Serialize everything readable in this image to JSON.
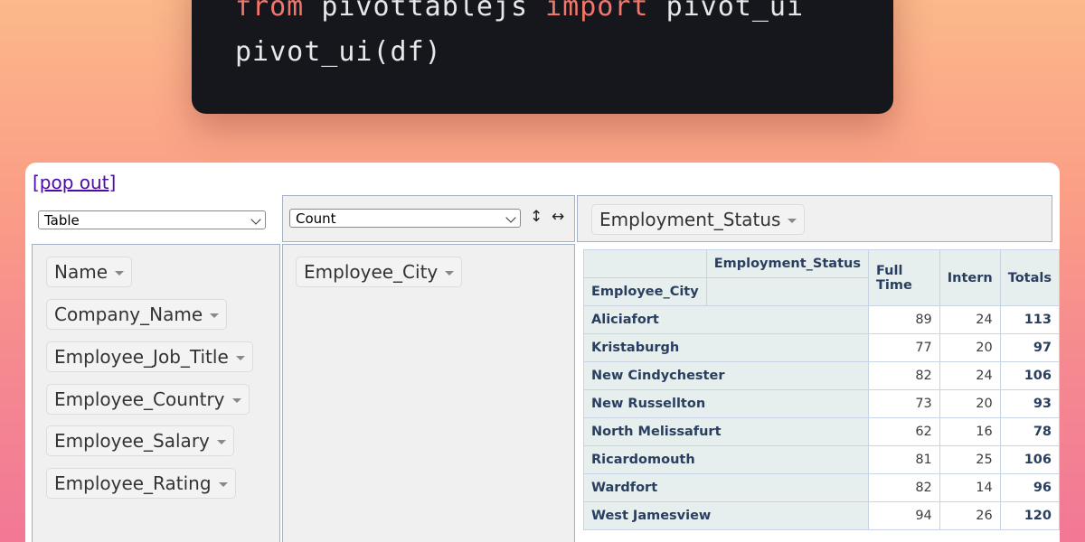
{
  "code": {
    "line1": {
      "kw1": "from",
      "mod": "pivottablejs",
      "kw2": "import",
      "name": "pivot_ui"
    },
    "line2": "pivot_ui(df)"
  },
  "colors": {
    "code_bg": "#15171c",
    "keyword": "#f2766c",
    "link": "#4b0ca8",
    "header_bg": "#e6eeee",
    "header_text": "#2a3f5f"
  },
  "popout_link": "[pop out]",
  "renderer_select": {
    "value": "Table"
  },
  "aggregator_select": {
    "value": "Count"
  },
  "sort_controls": {
    "row_order": "↕",
    "col_order": "↔"
  },
  "column_attributes": [
    {
      "label": "Employment_Status"
    }
  ],
  "row_attributes": [
    {
      "label": "Employee_City"
    }
  ],
  "unused_attributes": [
    {
      "label": "Name"
    },
    {
      "label": "Company_Name"
    },
    {
      "label": "Employee_Job_Title"
    },
    {
      "label": "Employee_Country"
    },
    {
      "label": "Employee_Salary"
    },
    {
      "label": "Employee_Rating"
    }
  ],
  "pivot_table": {
    "col_attr_header": "Employment_Status",
    "row_attr_header": "Employee_City",
    "columns": [
      "Full Time",
      "Intern",
      "Totals"
    ],
    "rows": [
      {
        "city": "Aliciafort",
        "full_time": "89",
        "intern": "24",
        "total": "113"
      },
      {
        "city": "Kristaburgh",
        "full_time": "77",
        "intern": "20",
        "total": "97"
      },
      {
        "city": "New Cindychester",
        "full_time": "82",
        "intern": "24",
        "total": "106"
      },
      {
        "city": "New Russellton",
        "full_time": "73",
        "intern": "20",
        "total": "93"
      },
      {
        "city": "North Melissafurt",
        "full_time": "62",
        "intern": "16",
        "total": "78"
      },
      {
        "city": "Ricardomouth",
        "full_time": "81",
        "intern": "25",
        "total": "106"
      },
      {
        "city": "Wardfort",
        "full_time": "82",
        "intern": "14",
        "total": "96"
      },
      {
        "city": "West Jamesview",
        "full_time": "94",
        "intern": "26",
        "total": "120"
      }
    ]
  }
}
